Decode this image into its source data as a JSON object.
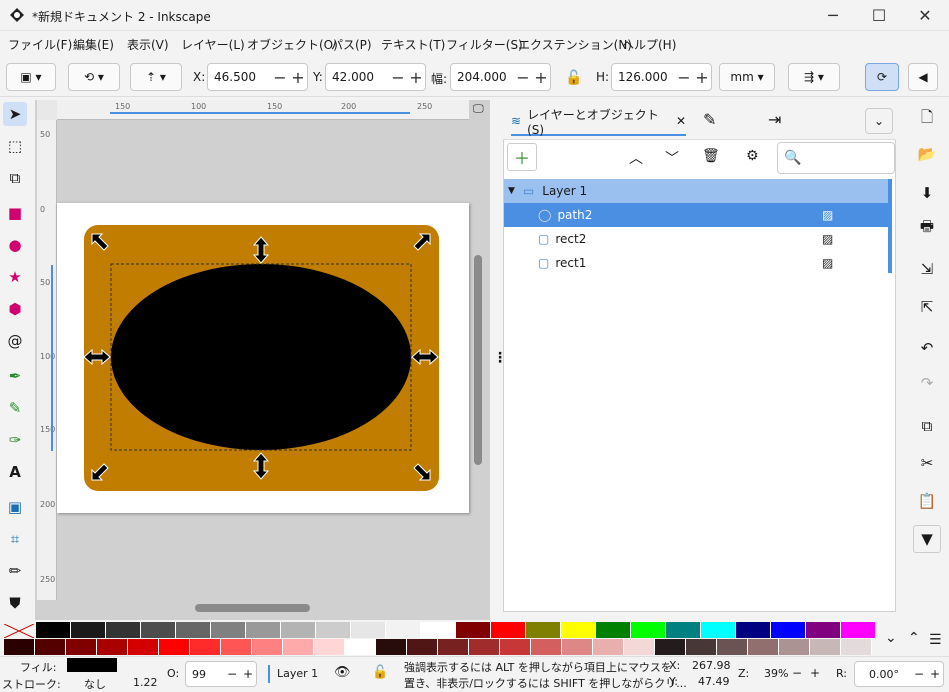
{
  "window": {
    "title": "*新規ドキュメント 2 - Inkscape"
  },
  "menus": [
    "ファイル(F)",
    "編集(E)",
    "表示(V)",
    "レイヤー(L)",
    "オブジェクト(O)",
    "パス(P)",
    "テキスト(T)",
    "フィルター(S)",
    "エクステンション(N)",
    "ヘルプ(H)"
  ],
  "toolbar": {
    "x_label": "X:",
    "x": "46.500",
    "y_label": "Y:",
    "y": "42.000",
    "w_label": "幅:",
    "w": "204.000",
    "h_label": "H:",
    "h": "126.000",
    "unit": "mm"
  },
  "rulers": {
    "h": [
      "150",
      "100",
      "150",
      "200",
      "250"
    ],
    "v": [
      "50",
      "0",
      "50",
      "100",
      "150",
      "200",
      "250"
    ]
  },
  "panel": {
    "tab_label": "レイヤーとオブジェクト(S)",
    "layer": "Layer 1",
    "objects": [
      "path2",
      "rect2",
      "rect1"
    ]
  },
  "colors": {
    "accent": "#4a90e2",
    "object_fill": "#c07d00",
    "selected_row": "#4a8fe2",
    "layer_row": "#99c0ef"
  },
  "palette": [
    "#000000",
    "#1a1a1a",
    "#333333",
    "#4d4d4d",
    "#666666",
    "#808080",
    "#999999",
    "#b3b3b3",
    "#cccccc",
    "#e6e6e6",
    "#f2f2f2",
    "#ffffff",
    "#800000",
    "#ff0000",
    "#808000",
    "#ffff00",
    "#008000",
    "#00ff00",
    "#008080",
    "#00ffff",
    "#000080",
    "#0000ff",
    "#800080",
    "#ff00ff"
  ],
  "palette2": [
    "#2b0000",
    "#550000",
    "#800000",
    "#aa0000",
    "#d40000",
    "#ff0000",
    "#ff2a2a",
    "#ff5555",
    "#ff8080",
    "#ffaaaa",
    "#ffd5d5",
    "#ffffff",
    "#280b0b",
    "#501616",
    "#782121",
    "#a02c2c",
    "#c83737",
    "#d35f5f",
    "#de8787",
    "#e9afaf",
    "#f4d7d7",
    "#241c1c",
    "#483737",
    "#6c5353",
    "#916f6f",
    "#ac9393",
    "#c8b7b7",
    "#e3dbdb"
  ],
  "status": {
    "fill_label": "フィル:",
    "stroke_label": "ストローク:",
    "stroke_value": "なし",
    "stroke_width": "1.22",
    "opacity_label": "O:",
    "opacity": "99",
    "layer": "Layer 1",
    "message_line1": "強調表示するには ALT を押しながら項目上にマウスを",
    "message_line2": "置き、非表示/ロックするには SHIFT を押しながらクリ...",
    "x_label": "X:",
    "x": "267.98",
    "y_label": "Y:",
    "y": "47.49",
    "zoom_label": "Z:",
    "zoom": "39%",
    "rot_label": "R:",
    "rotation": "0.00°"
  }
}
